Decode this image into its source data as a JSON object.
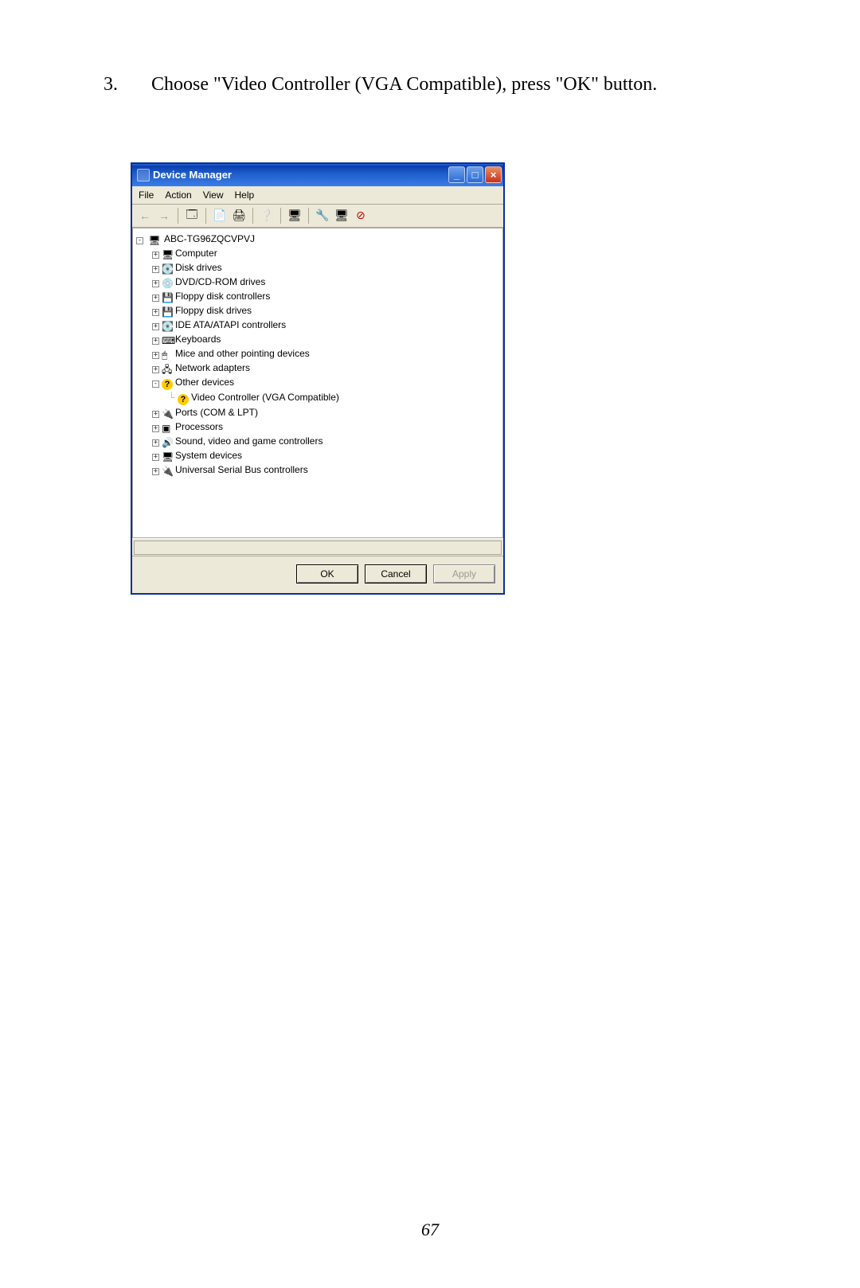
{
  "instruction": {
    "number": "3.",
    "text": "Choose \"Video Controller (VGA Compatible), press \"OK\" button."
  },
  "window": {
    "title": "Device Manager",
    "menus": {
      "file": "File",
      "action": "Action",
      "view": "View",
      "help": "Help"
    },
    "tree": {
      "root": "ABC-TG96ZQCVPVJ",
      "items": [
        "Computer",
        "Disk drives",
        "DVD/CD-ROM drives",
        "Floppy disk controllers",
        "Floppy disk drives",
        "IDE ATA/ATAPI controllers",
        "Keyboards",
        "Mice and other pointing devices",
        "Network adapters",
        "Other devices",
        "Ports (COM & LPT)",
        "Processors",
        "Sound, video and game controllers",
        "System devices",
        "Universal Serial Bus controllers"
      ],
      "other_child": "Video Controller (VGA Compatible)"
    },
    "buttons": {
      "ok": "OK",
      "cancel": "Cancel",
      "apply": "Apply"
    }
  },
  "page_number": "67"
}
